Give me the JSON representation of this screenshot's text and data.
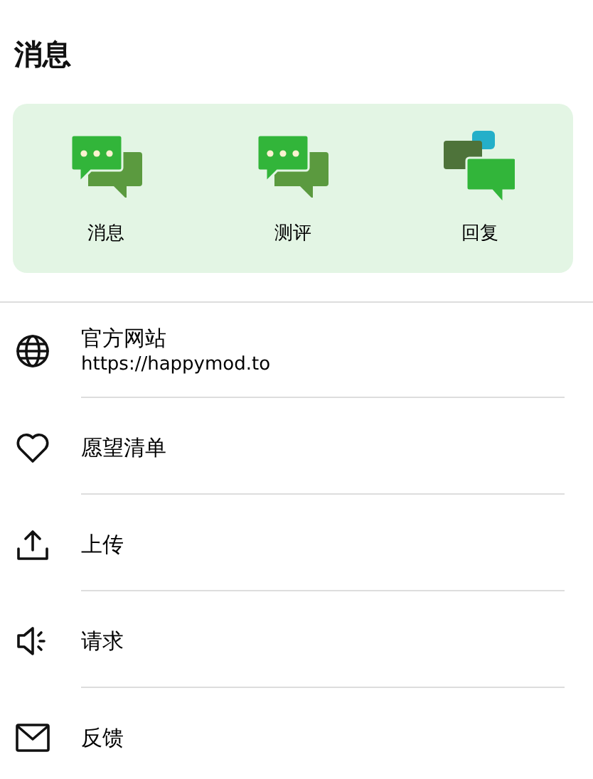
{
  "title": "消息",
  "shortcuts": [
    {
      "label": "消息",
      "kind": "chat"
    },
    {
      "label": "测评",
      "kind": "chat"
    },
    {
      "label": "回复",
      "kind": "reply"
    }
  ],
  "menu": [
    {
      "label": "官方网站",
      "subtitle": "https://happymod.to",
      "kind": "globe"
    },
    {
      "label": "愿望清单",
      "kind": "heart"
    },
    {
      "label": "上传",
      "kind": "upload"
    },
    {
      "label": "请求",
      "kind": "speaker"
    },
    {
      "label": "反馈",
      "kind": "mail"
    }
  ]
}
